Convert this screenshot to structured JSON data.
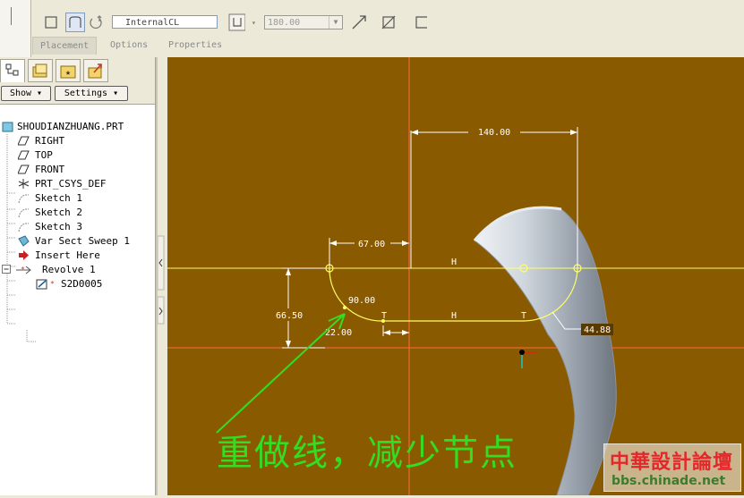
{
  "dashboard": {
    "reference_field": "InternalCL",
    "angle_value": "180.00",
    "tabs": [
      {
        "label": "Placement"
      },
      {
        "label": "Options"
      },
      {
        "label": "Properties"
      }
    ]
  },
  "navigator": {
    "show_button": "Show ▾",
    "settings_button": "Settings ▾",
    "tree": [
      {
        "label": "SHOUDIANZHUANG.PRT",
        "icon": "part-icon"
      },
      {
        "label": "RIGHT",
        "icon": "datum-plane-icon"
      },
      {
        "label": "TOP",
        "icon": "datum-plane-icon"
      },
      {
        "label": "FRONT",
        "icon": "datum-plane-icon"
      },
      {
        "label": "PRT_CSYS_DEF",
        "icon": "csys-icon"
      },
      {
        "label": "Sketch 1",
        "icon": "sketch-icon"
      },
      {
        "label": "Sketch 2",
        "icon": "sketch-icon"
      },
      {
        "label": "Sketch 3",
        "icon": "sketch-icon"
      },
      {
        "label": "Var Sect Sweep 1",
        "icon": "sweep-icon"
      },
      {
        "label": "Insert Here",
        "icon": "insert-arrow-icon"
      },
      {
        "label": "Revolve 1",
        "icon": "revolve-icon"
      },
      {
        "label": "S2D0005",
        "icon": "section-sketch-icon"
      }
    ]
  },
  "sketch": {
    "dimensions": {
      "d140": "140.00",
      "d67": "67.00",
      "d66": "66.50",
      "d90": "90.00",
      "d22": "22.00",
      "d44": "44.88"
    },
    "constraints": {
      "h1": "H",
      "h2": "H",
      "t1": "T",
      "t2": "T"
    }
  },
  "annotation": {
    "text": "重做线，减少节点"
  },
  "watermark": {
    "title": "中華設計論壇",
    "url": "bbs.chinade.net"
  },
  "colors": {
    "background": "#8a5a00",
    "sketch_line": "#ffff66",
    "annotation": "#33dd22",
    "reference_line": "#ff6a3d"
  }
}
